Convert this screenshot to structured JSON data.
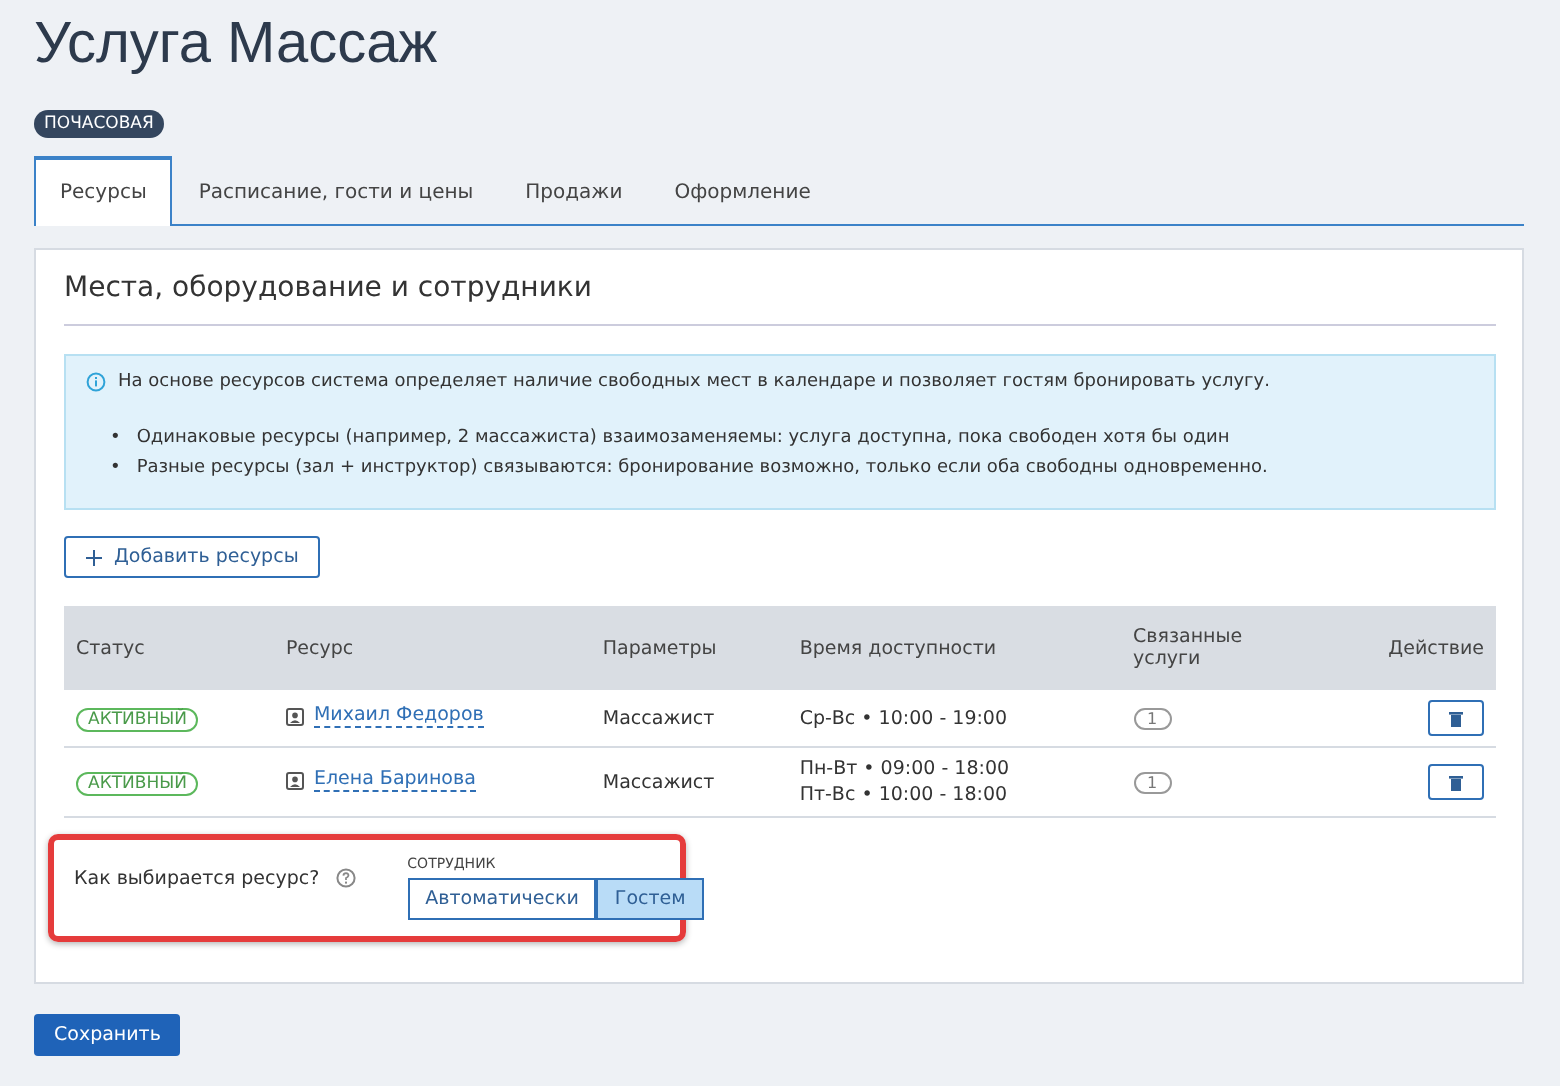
{
  "title": "Услуга Массаж",
  "badge": "ПОЧАСОВАЯ",
  "tabs": [
    {
      "label": "Ресурсы",
      "selected": true
    },
    {
      "label": "Расписание, гости и цены",
      "selected": false
    },
    {
      "label": "Продажи",
      "selected": false
    },
    {
      "label": "Оформление",
      "selected": false
    }
  ],
  "section_title": "Места, оборудование и сотрудники",
  "info": {
    "text": "На основе ресурсов система определяет наличие свободных мест в календаре и позволяет гостям бронировать услугу.",
    "bullets": [
      {
        "marker": "•",
        "text": "Одинаковые ресурсы (например, 2 массажиста) взаимозаменяемы: услуга доступна, пока свободен хотя бы один"
      },
      {
        "marker": "•",
        "text": "Разные ресурсы (зал + инструктор) связываются: бронирование возможно, только если оба свободны одновременно."
      }
    ]
  },
  "add_button": "Добавить ресурсы",
  "table": {
    "columns": [
      "Статус",
      "Ресурс",
      "Параметры",
      "Время доступности",
      "Связанные услуги",
      "Действие"
    ],
    "rows": [
      {
        "status": "АКТИВНЫЙ",
        "resource": "Михаил Федоров",
        "params": "Массажист",
        "times": [
          "Ср-Вс • 10:00 - 19:00"
        ],
        "linked": "1"
      },
      {
        "status": "АКТИВНЫЙ",
        "resource": "Елена Баринова",
        "params": "Массажист",
        "times": [
          "Пн-Вт • 09:00 - 18:00",
          "Пт-Вс • 10:00 - 18:00"
        ],
        "linked": "1"
      }
    ]
  },
  "selection": {
    "question": "Как выбирается ресурс?",
    "group_label": "СОТРУДНИК",
    "options": [
      {
        "label": "Автоматически",
        "selected": false
      },
      {
        "label": "Гостем",
        "selected": true
      }
    ]
  },
  "save_button": "Сохранить"
}
